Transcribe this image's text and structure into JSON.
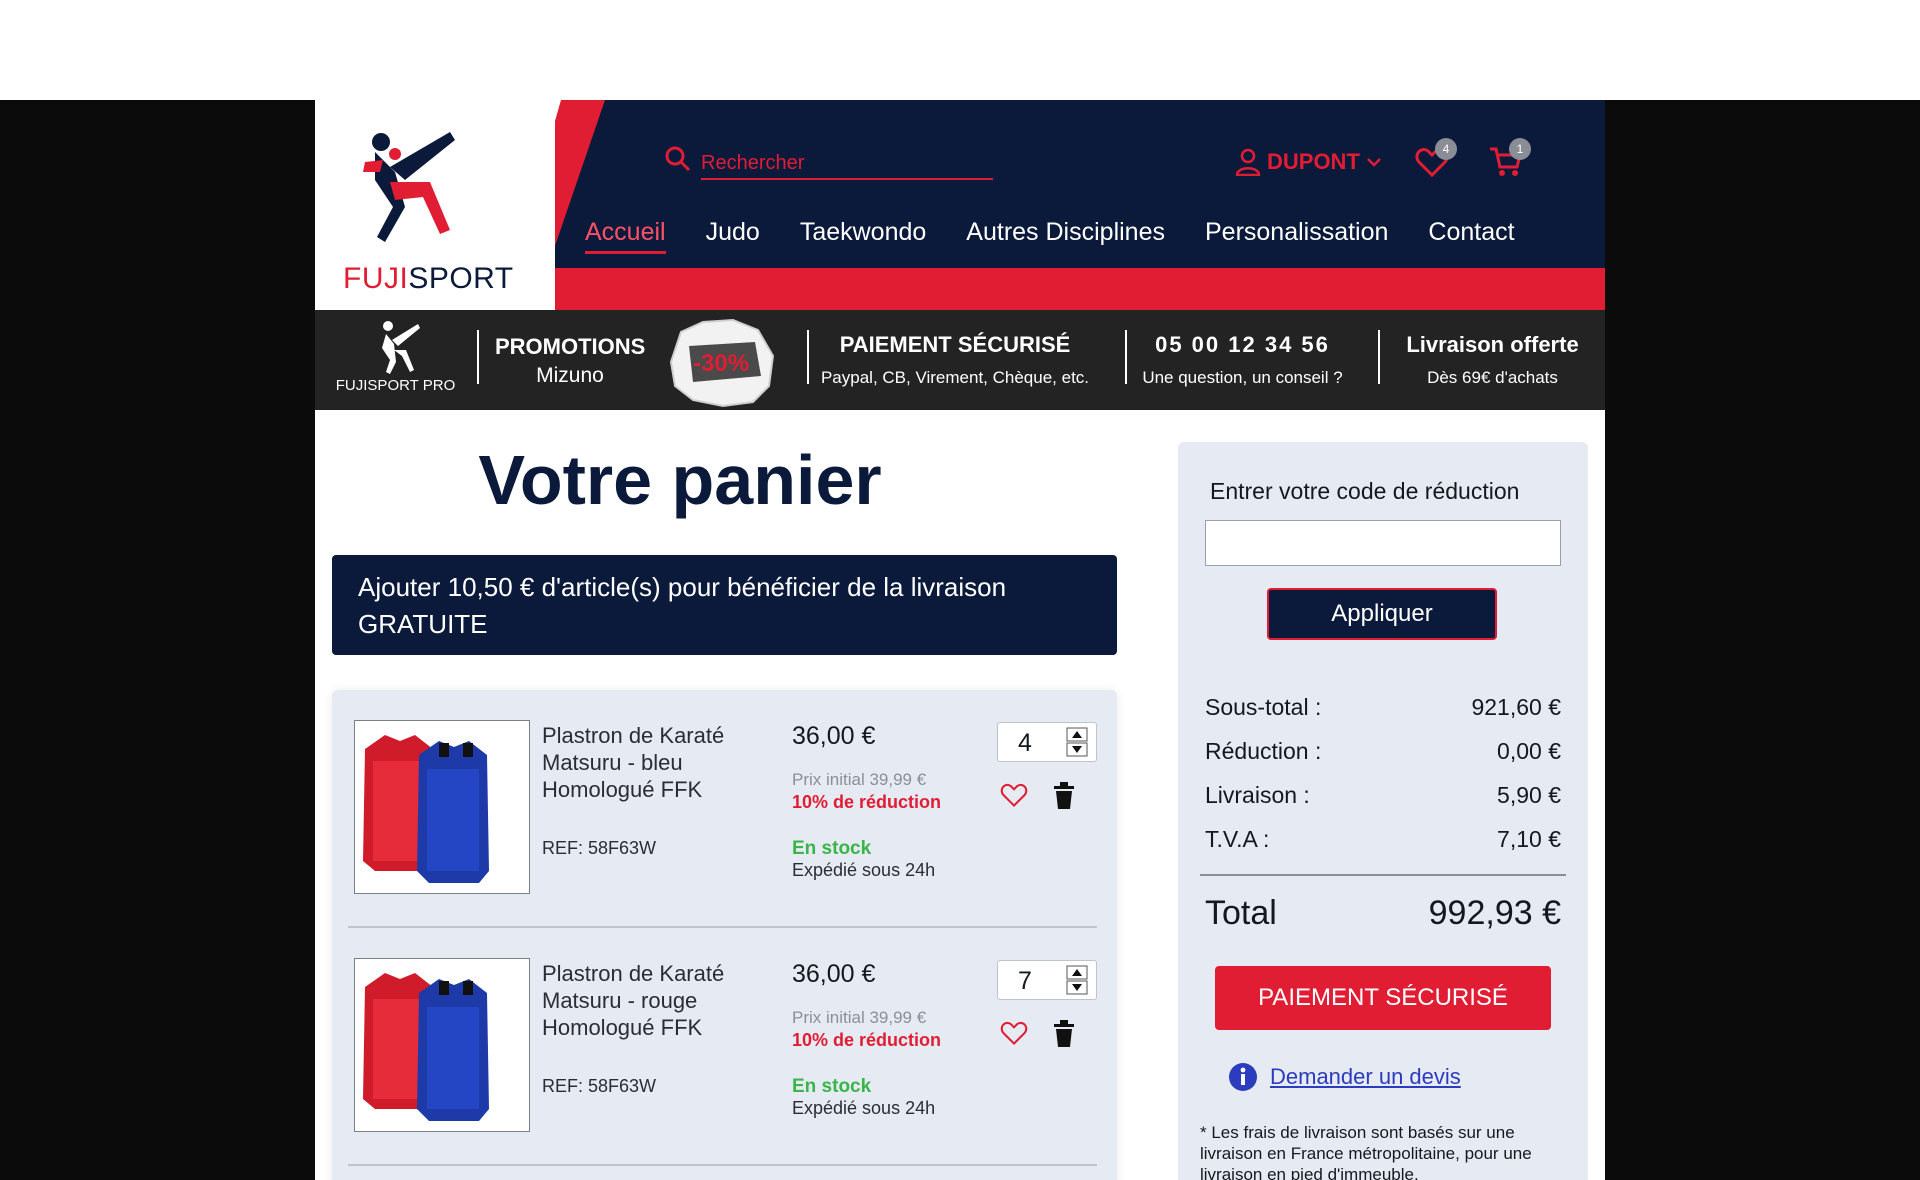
{
  "brand": {
    "name_part1": "FUJI",
    "name_part2": "SPORT",
    "pro_label": "FUJISPORT PRO"
  },
  "search": {
    "placeholder": "Rechercher"
  },
  "user": {
    "name": "DUPONT"
  },
  "wishlist": {
    "count": "4"
  },
  "cart_icon": {
    "count": "1"
  },
  "nav": {
    "items": [
      {
        "label": "Accueil",
        "active": true
      },
      {
        "label": "Judo"
      },
      {
        "label": "Taekwondo"
      },
      {
        "label": "Autres Disciplines"
      },
      {
        "label": "Personalissation"
      },
      {
        "label": "Contact"
      }
    ]
  },
  "infobar": {
    "promo_title": "PROMOTIONS",
    "promo_sub": "Mizuno",
    "promo_badge": "-30%",
    "payment_title": "PAIEMENT SÉCURISÉ",
    "payment_sub": "Paypal, CB, Virement, Chèque, etc.",
    "phone_title": "05 00 12 34 56",
    "phone_sub": "Une question, un conseil ?",
    "delivery_title": "Livraison offerte",
    "delivery_sub": "Dès 69€ d'achats"
  },
  "page": {
    "title": "Votre panier"
  },
  "freeship": {
    "text": "Ajouter 10,50 € d'article(s) pour bénéficier de la livraison GRATUITE"
  },
  "cart": {
    "items": [
      {
        "name": "Plastron de Karaté Matsuru - bleu Homologué FFK",
        "ref": "REF: 58F63W",
        "price": "36,00 €",
        "initial_price": "Prix initial 39,99 €",
        "discount": "10% de réduction",
        "stock": "En stock",
        "shipping": "Expédié sous 24h",
        "quantity": "4"
      },
      {
        "name": "Plastron de Karaté Matsuru - rouge Homologué FFK",
        "ref": "REF: 58F63W",
        "price": "36,00 €",
        "initial_price": "Prix initial 39,99 €",
        "discount": "10% de réduction",
        "stock": "En stock",
        "shipping": "Expédié sous 24h",
        "quantity": "7"
      }
    ]
  },
  "summary": {
    "code_label": "Entrer votre code de réduction",
    "apply_label": "Appliquer",
    "subtotal_label": "Sous-total :",
    "subtotal_value": "921,60 €",
    "reduction_label": "Réduction :",
    "reduction_value": "0,00 €",
    "delivery_label": "Livraison :",
    "delivery_value": "5,90 €",
    "tva_label": "T.V.A :",
    "tva_value": "7,10 €",
    "total_label": "Total",
    "total_value": "992,93 €",
    "pay_label": "PAIEMENT SÉCURISÉ",
    "quote_label": "Demander un devis",
    "note": "* Les frais de livraison sont basés sur une livraison en France métropolitaine, pour une livraison en pied d'immeuble."
  },
  "colors": {
    "navy": "#0b1a3b",
    "red": "#e11d34",
    "panel": "#e6eaf2",
    "green": "#39b54a"
  }
}
